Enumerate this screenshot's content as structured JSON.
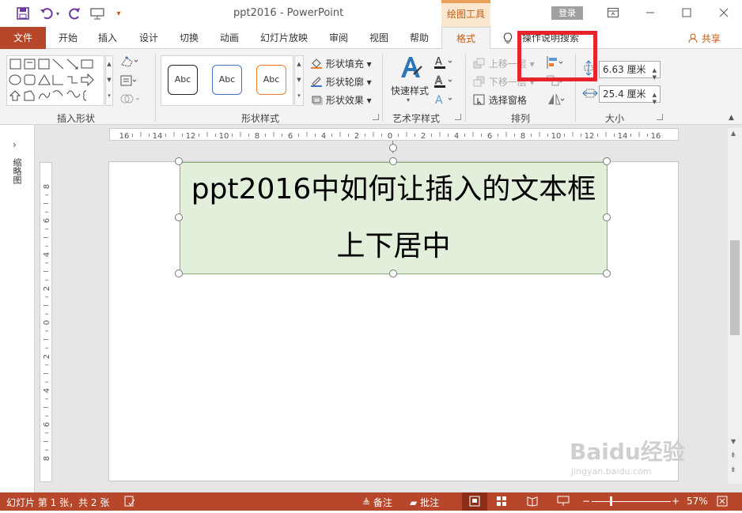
{
  "titlebar": {
    "title": "ppt2016  -  PowerPoint",
    "context_tab": "绘图工具",
    "login": "登录"
  },
  "tabs": {
    "file": "文件",
    "items": [
      "开始",
      "插入",
      "设计",
      "切换",
      "动画",
      "幻灯片放映",
      "审阅",
      "视图",
      "帮助"
    ],
    "format": "格式",
    "tell_me": "操作说明搜索",
    "share": "共享"
  },
  "ribbon": {
    "groups": {
      "insert_shapes": "插入形状",
      "shape_styles": "形状样式",
      "wordart_styles": "艺术字样式",
      "arrange": "排列",
      "size": "大小"
    },
    "style_preset": "Abc",
    "shape_fill": "形状填充",
    "shape_outline": "形状轮廓",
    "shape_effects": "形状效果",
    "quick_styles": "快速样式",
    "bring_forward": "上移一层",
    "send_backward": "下移一层",
    "selection_pane": "选择窗格",
    "height_value": "6.63 厘米",
    "width_value": "25.4 厘米"
  },
  "thumbnails_label": "缩略图",
  "hruler_labels": [
    "16",
    "14",
    "12",
    "10",
    "8",
    "6",
    "4",
    "2",
    "0",
    "2",
    "4",
    "6",
    "8",
    "10",
    "12",
    "14",
    "16"
  ],
  "vruler_labels": [
    "8",
    "6",
    "4",
    "2",
    "0",
    "2",
    "4",
    "6",
    "8"
  ],
  "slide": {
    "textbox_text": "ppt2016中如何让插入的文本框上下居中"
  },
  "statusbar": {
    "slide_info": "幻灯片 第 1 张，共 2 张",
    "notes": "备注",
    "comments": "批注",
    "zoom": "57%"
  },
  "watermark": {
    "brand": "Baidu经验",
    "url": "jingyan.baidu.com"
  },
  "colors": {
    "accent": "#b7472a",
    "context_orange": "#c55a11",
    "highlight": "#e8232b",
    "textbox_fill": "#e2efda"
  }
}
